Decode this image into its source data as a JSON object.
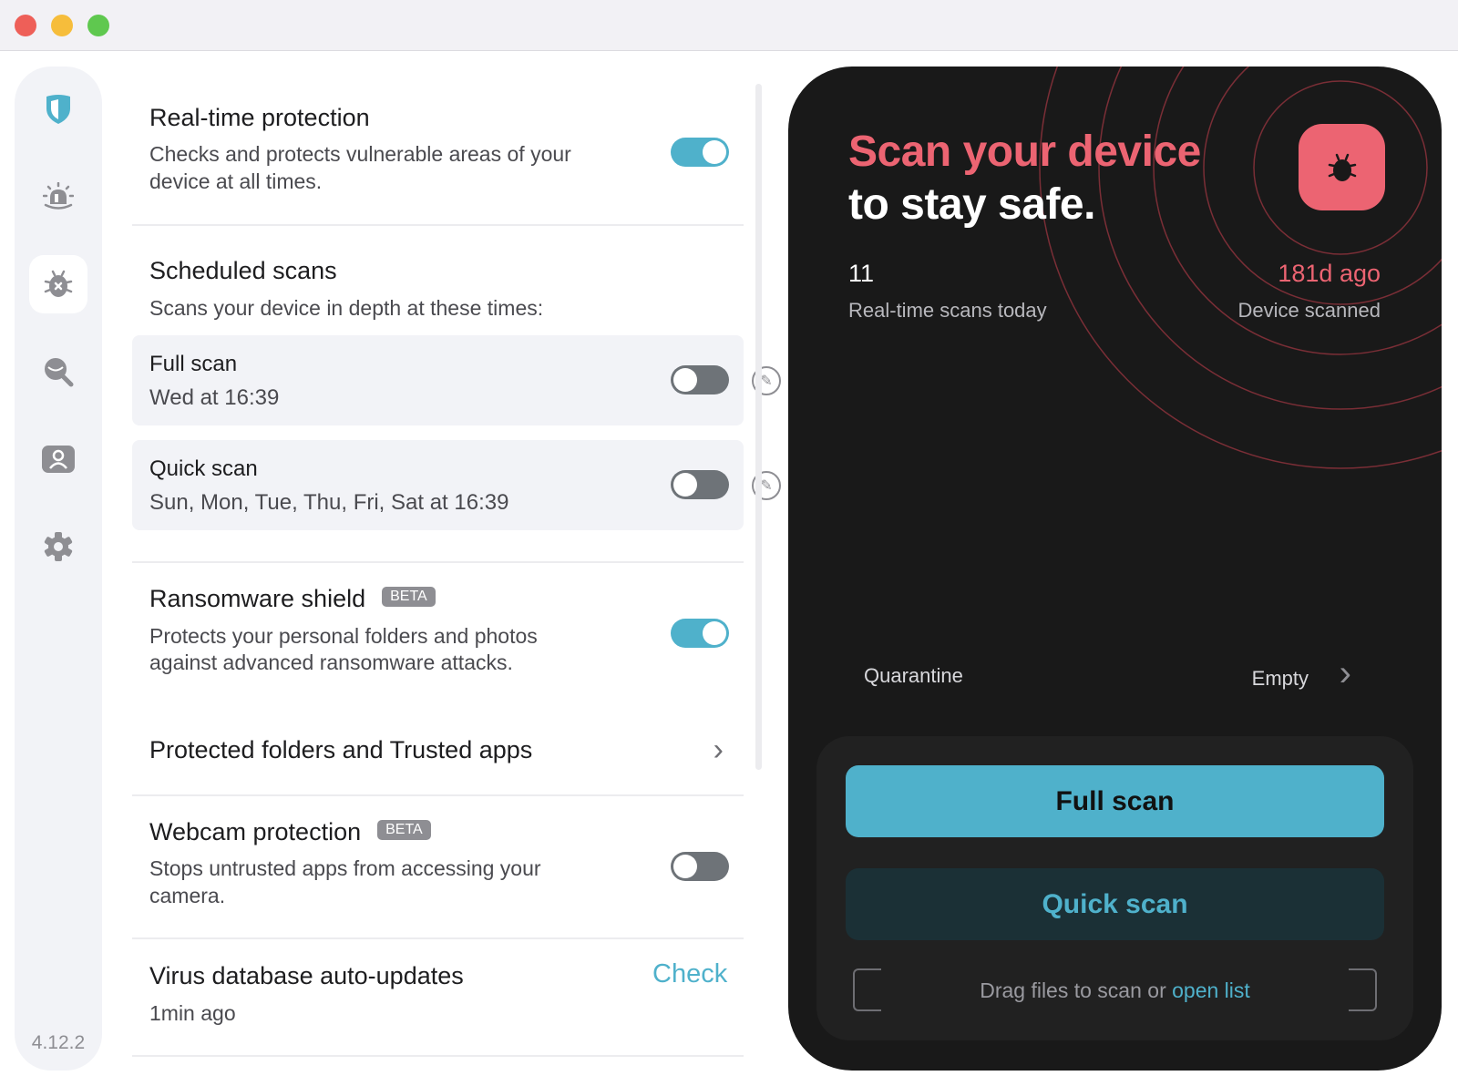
{
  "window": {
    "controls": [
      "close",
      "minimize",
      "zoom"
    ],
    "colors": {
      "close": "#ee5f58",
      "minimize": "#f6bd3b",
      "zoom": "#5fc84f"
    }
  },
  "sidebar": {
    "items": [
      {
        "name": "protection",
        "icon": "shield-icon",
        "active": false
      },
      {
        "name": "alerts",
        "icon": "siren-icon",
        "active": false
      },
      {
        "name": "virus-scan",
        "icon": "bug-icon",
        "active": true
      },
      {
        "name": "privacy",
        "icon": "eye-search-icon",
        "active": false
      },
      {
        "name": "account",
        "icon": "user-card-icon",
        "active": false
      },
      {
        "name": "settings",
        "icon": "gear-icon",
        "active": false
      }
    ],
    "version": "4.12.2"
  },
  "settings": {
    "realtime": {
      "title": "Real-time protection",
      "desc1": "Checks and protects vulnerable areas of your",
      "desc2": "device at all times.",
      "enabled": true
    },
    "scheduled": {
      "title": "Scheduled scans",
      "desc": "Scans your device in depth at these times:",
      "items": [
        {
          "name": "Full scan",
          "time": "Wed at 16:39",
          "enabled": false
        },
        {
          "name": "Quick scan",
          "time": "Sun, Mon, Tue, Thu, Fri, Sat at 16:39",
          "enabled": false
        }
      ]
    },
    "ransomware": {
      "title": "Ransomware shield",
      "badge": "BETA",
      "desc1": "Protects your personal folders and photos",
      "desc2": "against advanced ransomware attacks.",
      "enabled": true
    },
    "protected_folders": {
      "title": "Protected folders and Trusted apps"
    },
    "webcam": {
      "title": "Webcam protection",
      "badge": "BETA",
      "desc1": "Stops untrusted apps from accessing your",
      "desc2": "camera.",
      "enabled": false
    },
    "virus_db": {
      "title": "Virus database auto-updates",
      "status": "1min ago",
      "action": "Check"
    }
  },
  "scan_panel": {
    "heading_line1": "Scan your device",
    "heading_line2": "to stay safe.",
    "scans_today": {
      "value": "11",
      "label": "Real-time scans today"
    },
    "last_scan": {
      "value": "181d ago",
      "label": "Device scanned"
    },
    "quarantine": {
      "label": "Quarantine",
      "value": "Empty"
    },
    "full_scan_label": "Full scan",
    "quick_scan_label": "Quick scan",
    "drag_text": "Drag files to scan or ",
    "drag_link": "open list"
  },
  "colors": {
    "accent": "#4fb1cb",
    "alert": "#ec6472",
    "panel": "#191919"
  }
}
